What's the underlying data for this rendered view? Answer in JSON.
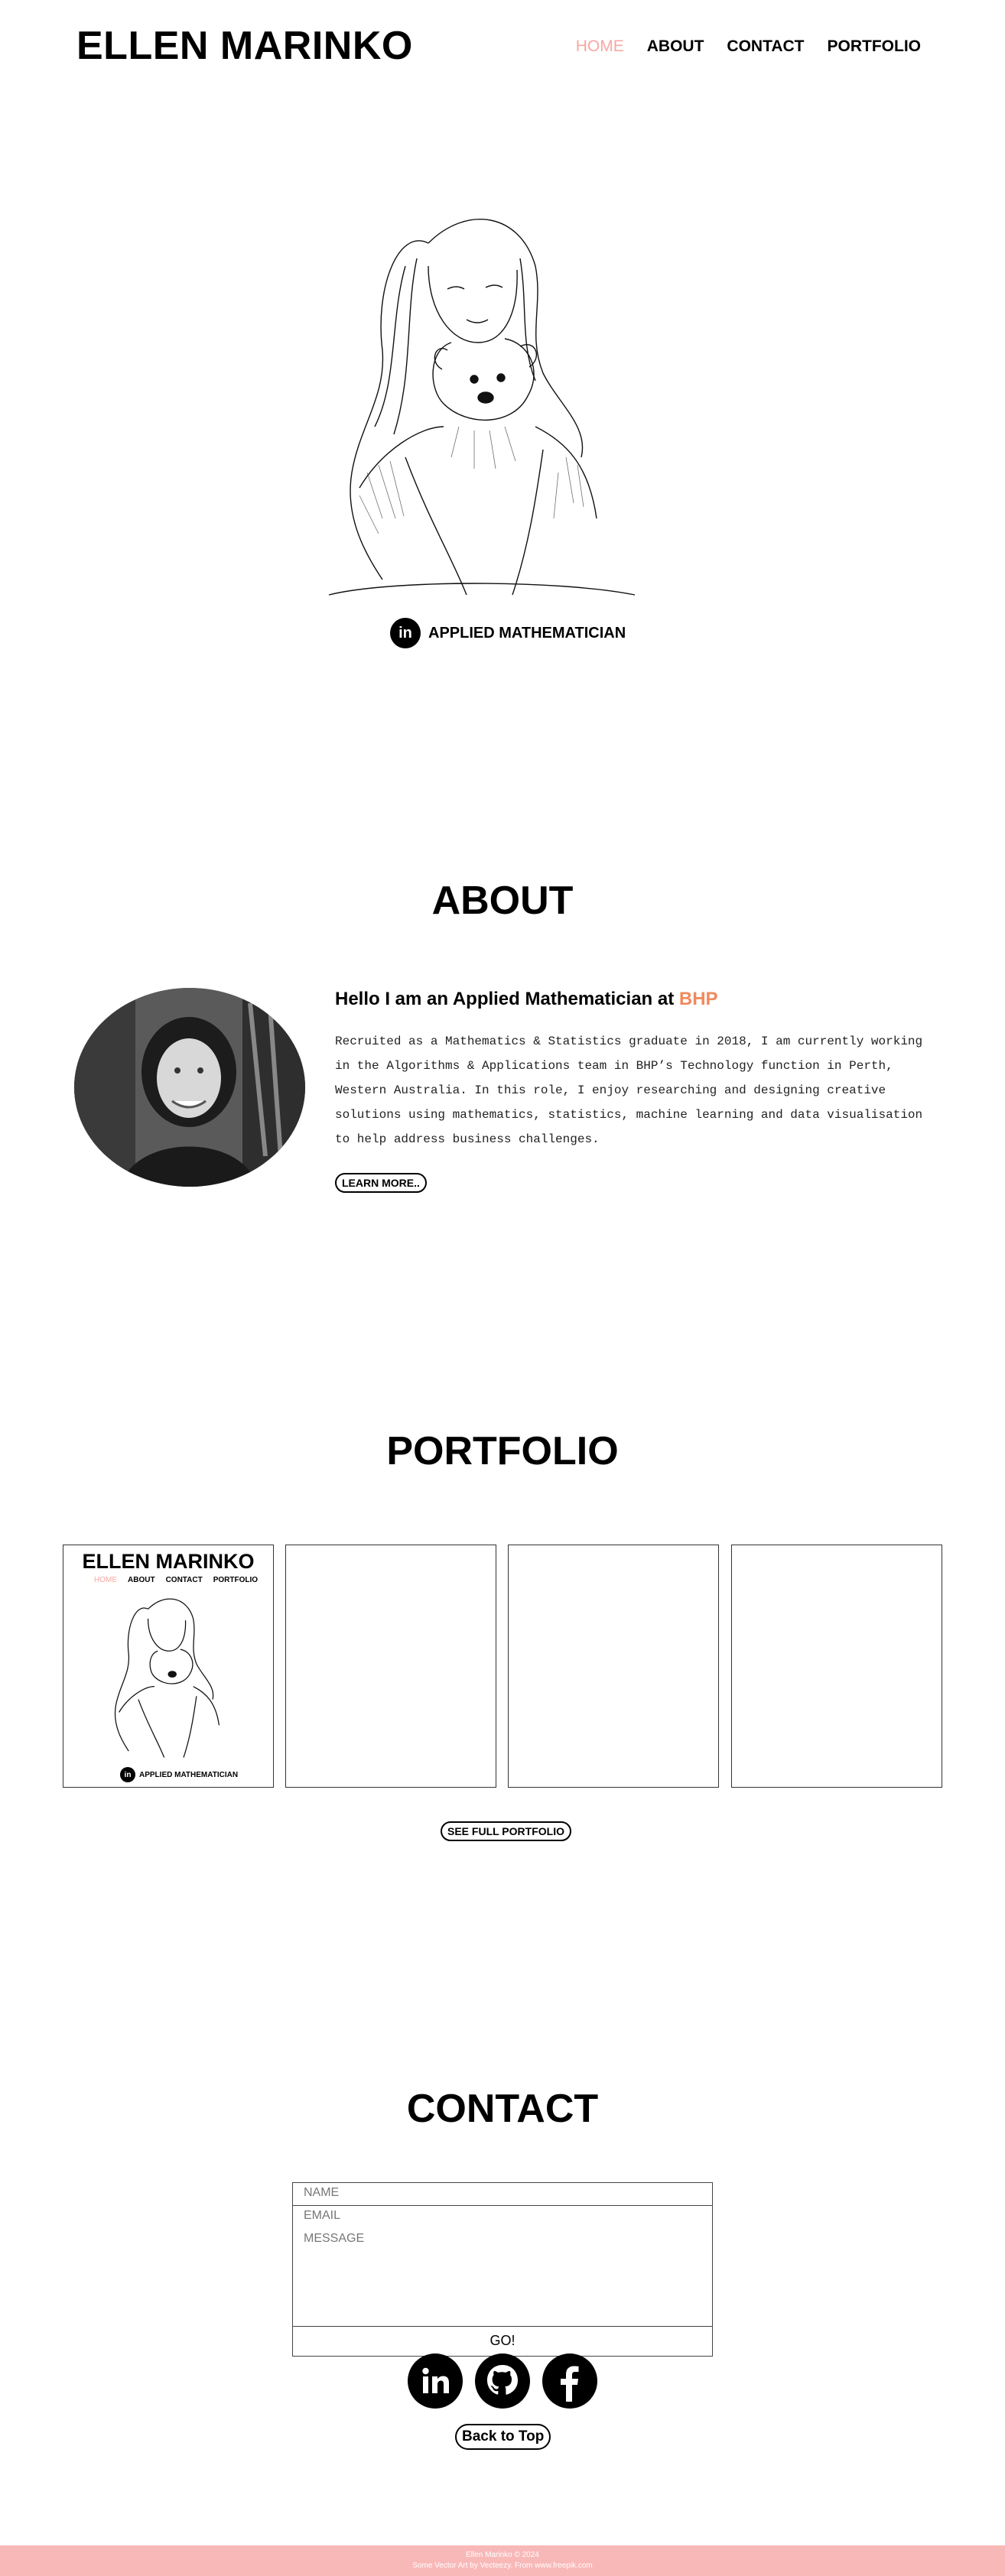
{
  "header": {
    "brand": "ELLEN MARINKO",
    "nav": [
      {
        "label": "HOME",
        "active": true
      },
      {
        "label": "ABOUT",
        "active": false
      },
      {
        "label": "CONTACT",
        "active": false
      },
      {
        "label": "PORTFOLIO",
        "active": false
      }
    ]
  },
  "hero": {
    "tagline": "APPLIED MATHEMATICIAN",
    "linkedin_icon_text": "in"
  },
  "about": {
    "title": "ABOUT",
    "heading_prefix": "Hello I am an Applied Mathematician at ",
    "heading_accent": "BHP",
    "body_lines": [
      "Recruited as a Mathematics & Statistics graduate in 2018, I am currently working",
      "in the Algorithms & Applications team in BHP’s Technology function in Perth,",
      "Western Australia. In this role, I enjoy researching and designing creative",
      "solutions using mathematics, statistics, machine learning and data visualisation",
      "to help address business challenges."
    ],
    "learn_more": "LEARN MORE.."
  },
  "portfolio": {
    "title": "PORTFOLIO",
    "preview": {
      "brand": "ELLEN MARINKO",
      "nav": [
        "HOME",
        "ABOUT",
        "CONTACT",
        "PORTFOLIO"
      ],
      "tagline": "APPLIED MATHEMATICIAN"
    },
    "see_full": "SEE FULL PORTFOLIO"
  },
  "contact": {
    "title": "CONTACT",
    "name_placeholder": "NAME",
    "email_placeholder": "EMAIL",
    "message_placeholder": "MESSAGE",
    "submit": "GO!",
    "socials": [
      "linkedin-icon",
      "github-icon",
      "facebook-icon"
    ],
    "back_to_top": "Back to Top"
  },
  "footer": {
    "line1": "Ellen Marinko © 2024",
    "line2": "Some Vector Art by Vecteezy. From www.freepik.com"
  },
  "colors": {
    "nav_active": "#f7a8a4",
    "accent": "#f08a5d",
    "footer_bg": "#f9b8b8"
  }
}
